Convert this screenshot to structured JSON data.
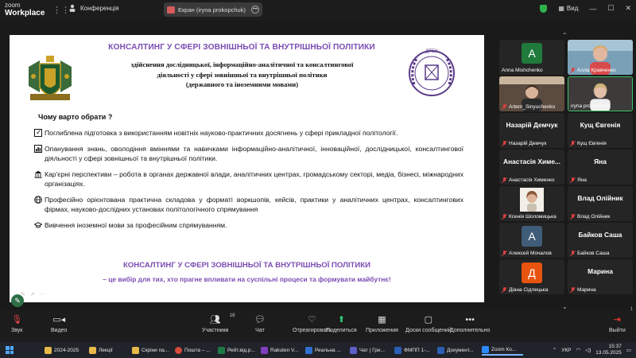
{
  "topbar": {
    "logo_line1": "zoom",
    "logo_line2": "Workplace",
    "conference_label": "Конференція",
    "screen_share_label": "Екран (iryna prokopchuk)",
    "view_label": "Вид"
  },
  "slide": {
    "title": "КОНСАЛТИНГ У СФЕРІ ЗОВНІШНЬОЇ ТА ВНУТРІШНЬОЇ ПОЛІТИКИ",
    "subtitle_line1": "здійснення дослідницької, інформаційно-аналітичної та консалтингової",
    "subtitle_line2": "діяльності у сфері зовнішньої та внутрішньої політики",
    "subtitle_line3": "(державного та іноземними мовами)",
    "why_label": "Чому варто обрати ?",
    "points": [
      "Поглиблена підготовка з використанням новітніх науково-практичних досягнень у сфері прикладної політології.",
      "Опанування знань, оволодіння вміннями та навичками інформаційно-аналітичної, інноваційної, дослідницької, консалтингової діяльності у сфері зовнішньої та внутрішньої політики.",
      "Кар'єрні перспективи – робота в органах державної влади, аналітичних центрах, громадському секторі, медіа, бізнесі, міжнародних організаціях.",
      "Професійно орієнтована практична складова у форматі воркшопів, кейсів, практики у аналітичних центрах, консалтингових фірмах, науково-дослідних установах політологічного спрямування",
      "Вивчення іноземної мови за професійним спрямуванням."
    ],
    "bottom_title": "КОНСАЛТИНГ У СФЕРІ ЗОВНІШНЬОЇ ТА ВНУТРІШНЬОЇ ПОЛІТИКИ",
    "bottom_subtitle": "– це вибір для тих, хто прагне впливати на суспільні процеси та формувати майбутнє!",
    "right_crest_text": "ДТЕУ"
  },
  "gallery": {
    "page_number": "1\n2",
    "tiles": [
      {
        "name": "Anna Mishchenko",
        "letter": "A",
        "color": "#1f7a3c"
      },
      {
        "name": "Алла Кравченко"
      },
      {
        "name": "Artem_Sinyuchenko"
      },
      {
        "name": "iryna prokopchuk"
      },
      {
        "name": "Назарій Демчук",
        "big": "Назарій Демчук"
      },
      {
        "name": "Кущ Євгенія",
        "big": "Кущ Євгенія"
      },
      {
        "name": "Анастасія Хименко",
        "big": "Анастасія Химе..."
      },
      {
        "name": "Яна",
        "big": "Яна"
      },
      {
        "name": "Ксенія Шоломицька"
      },
      {
        "name": "Влад Олійник",
        "big": "Влад Олійник"
      },
      {
        "name": "Алексей Мочалов",
        "letter": "A",
        "color": "#3f5d79"
      },
      {
        "name": "Байков Саша",
        "big": "Байков Саша"
      },
      {
        "name": "Діана Сідлецька",
        "letter": "Д",
        "color": "#e8540f"
      },
      {
        "name": "Марина",
        "big": "Марина"
      }
    ]
  },
  "controls": {
    "audio": "Звук",
    "video": "Видео",
    "participants": "Участники",
    "participants_count": "18",
    "chat": "Чат",
    "react": "Отреагировать",
    "share": "Поделиться",
    "apps": "Приложения",
    "whiteboards": "Доски сообщений",
    "more": "Дополнительно",
    "leave": "Выйти"
  },
  "taskbar": {
    "items": [
      {
        "label": "2024-2025",
        "color": "#e8b84a"
      },
      {
        "label": "Лекції",
        "color": "#e8b84a"
      },
      {
        "label": "Скріни па...",
        "color": "#e8b84a"
      },
      {
        "label": "Пошта – ...",
        "color": "#d84a3a"
      },
      {
        "label": "Рейт.від.р...",
        "color": "#1e7a44"
      },
      {
        "label": "Rakuten V...",
        "color": "#7f3fbf"
      },
      {
        "label": "Реальна ...",
        "color": "#2f6fd0"
      },
      {
        "label": "Чат | Гри...",
        "color": "#5b5fc7"
      },
      {
        "label": "ФМПП 1-...",
        "color": "#2b5fb4"
      },
      {
        "label": "Документ...",
        "color": "#2b5fb4"
      },
      {
        "label": "Zoom Ко...",
        "color": "#2d8cff"
      }
    ],
    "lang": "УКР",
    "time": "15:37",
    "date": "13.05.2025"
  }
}
